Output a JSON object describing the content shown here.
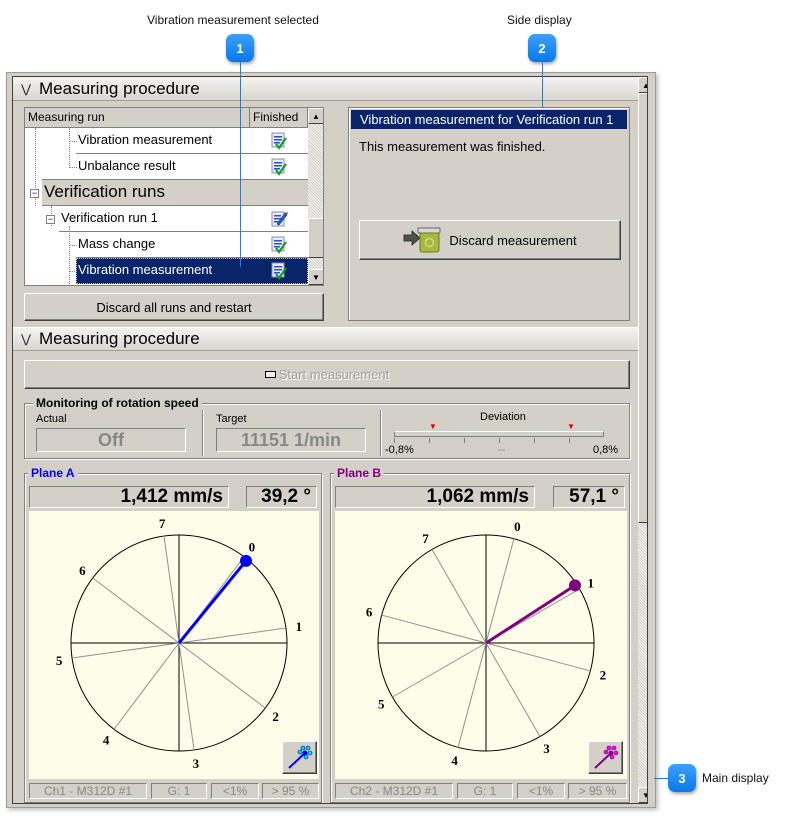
{
  "callouts": [
    {
      "number": "1",
      "label": "Vibration measurement selected"
    },
    {
      "number": "2",
      "label": "Side display"
    },
    {
      "number": "3",
      "label": "Main display"
    }
  ],
  "top_section": {
    "title": "Measuring procedure",
    "tree": {
      "columns": [
        "Measuring run",
        "Finished"
      ],
      "rows": [
        {
          "label": "Vibration measurement",
          "status_icon": "finished-check-icon"
        },
        {
          "label": "Unbalance result",
          "status_icon": "finished-check-icon"
        },
        {
          "label": "Verification runs",
          "group": true
        },
        {
          "label": "Verification run 1",
          "status_icon": "edit-pencil-icon"
        },
        {
          "label": "Mass change",
          "status_icon": "finished-check-icon"
        },
        {
          "label": "Vibration measurement",
          "status_icon": "finished-check-icon",
          "selected": true
        }
      ]
    },
    "discard_all_label": "Discard all runs and restart",
    "side_display": {
      "title": "Vibration measurement for Verification run 1",
      "message": "This measurement was finished.",
      "discard_label": "Discard measurement"
    }
  },
  "bottom_section": {
    "title": "Measuring procedure",
    "start_label": "Start measurement",
    "monitoring": {
      "title": "Monitoring of rotation speed",
      "actual_label": "Actual",
      "actual_value": "Off",
      "target_label": "Target",
      "target_value": "11151 1/min",
      "deviation_label": "Deviation",
      "deviation_min": "-0,8%",
      "deviation_max": "0,8%",
      "deviation_value": "--"
    },
    "planes": [
      {
        "name": "Plane A",
        "color": "#0000ff",
        "dot_color": "#00e0e0",
        "amplitude": "1,412 mm/s",
        "angle": "39,2 °",
        "angle_deg": 39.2,
        "positions": [
          "0",
          "1",
          "2",
          "3",
          "4",
          "5",
          "6",
          "7"
        ],
        "position_offset_deg": 37,
        "status": [
          "Ch1 - M312D #1",
          "G: 1",
          "<1%",
          "> 95 %"
        ]
      },
      {
        "name": "Plane B",
        "color": "#800080",
        "dot_color": "#ff00ff",
        "amplitude": "1,062 mm/s",
        "angle": "57,1 °",
        "angle_deg": 57.1,
        "positions": [
          "0",
          "1",
          "2",
          "3",
          "4",
          "5",
          "6",
          "7"
        ],
        "position_offset_deg": 15,
        "status": [
          "Ch2 - M312D #1",
          "G: 1",
          "<1%",
          "> 95 %"
        ]
      }
    ]
  }
}
